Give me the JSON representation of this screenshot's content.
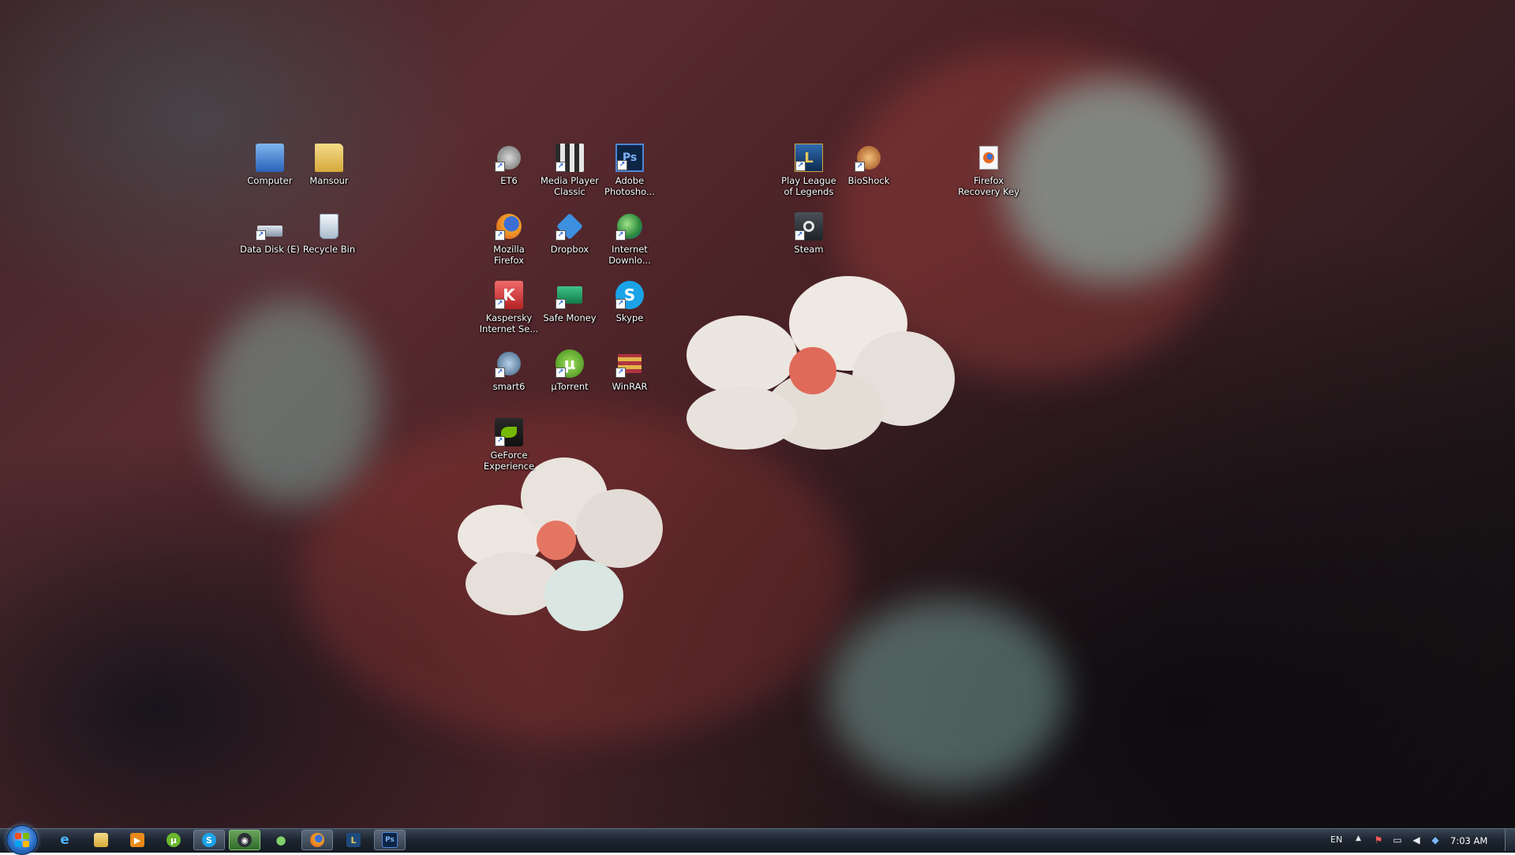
{
  "desktop_icons": [
    {
      "id": "computer",
      "label": "Computer",
      "icon": "computer-icon",
      "color": "#3a7fd6"
    },
    {
      "id": "mansour",
      "label": "Mansour",
      "icon": "user-folder-icon",
      "color": "#e8c35a"
    },
    {
      "id": "data-disk",
      "label": "Data Disk (E)",
      "icon": "drive-icon",
      "color": "#9aa6b4"
    },
    {
      "id": "recycle-bin",
      "label": "Recycle Bin",
      "icon": "recycle-bin-icon",
      "color": "#c9d6e2"
    },
    {
      "id": "et6",
      "label": "ET6",
      "icon": "et6-icon",
      "color": "#8c8c8c"
    },
    {
      "id": "media-player-classic",
      "label": "Media Player Classic",
      "icon": "film-icon",
      "color": "#dcdcdc"
    },
    {
      "id": "adobe-photoshop",
      "label": "Adobe Photosho...",
      "icon": "photoshop-icon",
      "color": "#1c3b6e",
      "glyph": "Ps"
    },
    {
      "id": "mozilla-firefox",
      "label": "Mozilla Firefox",
      "icon": "firefox-icon",
      "color": "#e66a1f"
    },
    {
      "id": "dropbox",
      "label": "Dropbox",
      "icon": "dropbox-icon",
      "color": "#3d8fe0"
    },
    {
      "id": "internet-download",
      "label": "Internet Downlo...",
      "icon": "idm-icon",
      "color": "#3aa84a"
    },
    {
      "id": "kaspersky",
      "label": "Kaspersky Internet Se...",
      "icon": "kaspersky-icon",
      "color": "#d63a3a",
      "glyph": "K"
    },
    {
      "id": "safe-money",
      "label": "Safe Money",
      "icon": "safe-money-icon",
      "color": "#1f9a5e"
    },
    {
      "id": "skype",
      "label": "Skype",
      "icon": "skype-icon",
      "color": "#1ba3e8",
      "glyph": "S"
    },
    {
      "id": "smart6",
      "label": "smart6",
      "icon": "smart6-icon",
      "color": "#5a7a9a"
    },
    {
      "id": "utorrent",
      "label": "µTorrent",
      "icon": "utorrent-icon",
      "color": "#6ab82e",
      "glyph": "µ"
    },
    {
      "id": "winrar",
      "label": "WinRAR",
      "icon": "winrar-icon",
      "color": "#c8962d"
    },
    {
      "id": "geforce-experience",
      "label": "GeForce Experience",
      "icon": "nvidia-icon",
      "color": "#5a9a1a"
    },
    {
      "id": "play-league",
      "label": "Play League of Legends",
      "icon": "league-icon",
      "color": "#1d4a7a",
      "glyph": "L"
    },
    {
      "id": "bioshock",
      "label": "BioShock",
      "icon": "bioshock-icon",
      "color": "#b5642a"
    },
    {
      "id": "steam",
      "label": "Steam",
      "icon": "steam-icon",
      "color": "#3a3f47"
    },
    {
      "id": "firefox-recovery-key",
      "label": "Firefox Recovery Key",
      "icon": "firefox-document-icon",
      "color": "#f2f2f2"
    }
  ],
  "taskbar": {
    "pinned": [
      {
        "id": "ie",
        "icon": "internet-explorer-icon",
        "glyph": "e",
        "color": "#3b9be0",
        "open": false
      },
      {
        "id": "explorer",
        "icon": "folder-icon",
        "glyph": "",
        "color": "#e8c35a",
        "open": false
      },
      {
        "id": "media-player",
        "icon": "media-player-icon",
        "glyph": "▶",
        "color": "#e88a1a",
        "open": false
      },
      {
        "id": "utorrent",
        "icon": "utorrent-icon",
        "glyph": "µ",
        "color": "#6ab82e",
        "open": false
      },
      {
        "id": "skype",
        "icon": "skype-icon",
        "glyph": "S",
        "color": "#1ba3e8",
        "open": true
      },
      {
        "id": "steam",
        "icon": "steam-icon",
        "glyph": "◉",
        "color": "#2a2f36",
        "open": true,
        "active": true
      },
      {
        "id": "idm",
        "icon": "idm-icon",
        "glyph": "●",
        "color": "#3aa84a",
        "open": false
      },
      {
        "id": "firefox",
        "icon": "firefox-icon",
        "glyph": "●",
        "color": "#e66a1f",
        "open": true
      },
      {
        "id": "league",
        "icon": "league-icon",
        "glyph": "L",
        "color": "#1d4a7a",
        "open": false
      },
      {
        "id": "photoshop",
        "icon": "photoshop-icon",
        "glyph": "Ps",
        "color": "#1c3b6e",
        "open": true
      }
    ],
    "tray": {
      "language": "EN",
      "icons": [
        "show-hidden-icons-icon",
        "action-center-icon",
        "network-icon",
        "volume-icon",
        "dropbox-tray-icon"
      ],
      "time": "7:03 AM"
    }
  }
}
